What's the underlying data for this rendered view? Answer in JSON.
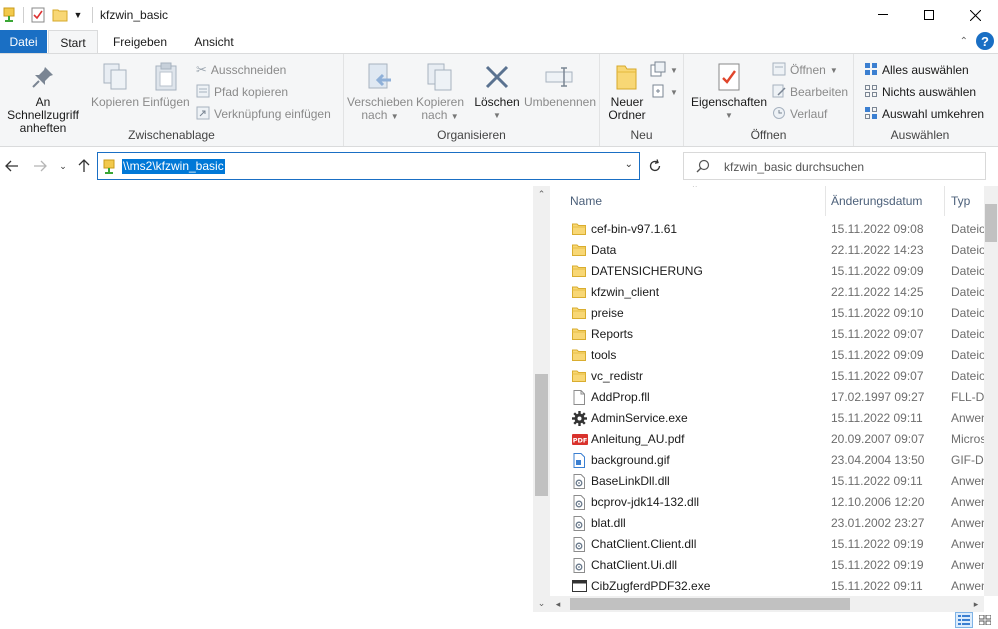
{
  "window": {
    "title": "kfzwin_basic"
  },
  "tabs": {
    "file": "Datei",
    "start": "Start",
    "share": "Freigeben",
    "view": "Ansicht"
  },
  "help": {
    "label": "?"
  },
  "ribbon": {
    "clipboard": {
      "label": "Zwischenablage",
      "pin_line1": "An Schnellzugriff",
      "pin_line2": "anheften",
      "copy": "Kopieren",
      "paste": "Einfügen",
      "cut": "Ausschneiden",
      "copy_path": "Pfad kopieren",
      "paste_shortcut": "Verknüpfung einfügen"
    },
    "organize": {
      "label": "Organisieren",
      "move_line1": "Verschieben",
      "move_line2": "nach",
      "copyto_line1": "Kopieren",
      "copyto_line2": "nach",
      "delete": "Löschen",
      "rename": "Umbenennen"
    },
    "new": {
      "label": "Neu",
      "folder_line1": "Neuer",
      "folder_line2": "Ordner"
    },
    "open": {
      "label": "Öffnen",
      "properties": "Eigenschaften",
      "open": "Öffnen",
      "edit": "Bearbeiten",
      "history": "Verlauf"
    },
    "select": {
      "label": "Auswählen",
      "all": "Alles auswählen",
      "none": "Nichts auswählen",
      "invert": "Auswahl umkehren"
    }
  },
  "address": {
    "path": "\\\\ms2\\kfzwin_basic"
  },
  "search": {
    "placeholder": "kfzwin_basic durchsuchen"
  },
  "columns": {
    "name": "Name",
    "date": "Änderungsdatum",
    "type": "Typ"
  },
  "files": [
    {
      "name": "cef-bin-v97.1.61",
      "date": "15.11.2022 09:08",
      "type": "Dateiordner",
      "icon": "folder"
    },
    {
      "name": "Data",
      "date": "22.11.2022 14:23",
      "type": "Dateiordner",
      "icon": "folder"
    },
    {
      "name": "DATENSICHERUNG",
      "date": "15.11.2022 09:09",
      "type": "Dateiordner",
      "icon": "folder"
    },
    {
      "name": "kfzwin_client",
      "date": "22.11.2022 14:25",
      "type": "Dateiordner",
      "icon": "folder"
    },
    {
      "name": "preise",
      "date": "15.11.2022 09:10",
      "type": "Dateiordner",
      "icon": "folder"
    },
    {
      "name": "Reports",
      "date": "15.11.2022 09:07",
      "type": "Dateiordner",
      "icon": "folder"
    },
    {
      "name": "tools",
      "date": "15.11.2022 09:09",
      "type": "Dateiordner",
      "icon": "folder"
    },
    {
      "name": "vc_redistr",
      "date": "15.11.2022 09:07",
      "type": "Dateiordner",
      "icon": "folder"
    },
    {
      "name": "AddProp.fll",
      "date": "17.02.1997 09:27",
      "type": "FLL-Datei",
      "icon": "file"
    },
    {
      "name": "AdminService.exe",
      "date": "15.11.2022 09:11",
      "type": "Anwendung",
      "icon": "gear"
    },
    {
      "name": "Anleitung_AU.pdf",
      "date": "20.09.2007 09:07",
      "type": "Microsoft Edge PDF",
      "icon": "pdf"
    },
    {
      "name": "background.gif",
      "date": "23.04.2004 13:50",
      "type": "GIF-Datei",
      "icon": "image"
    },
    {
      "name": "BaseLinkDll.dll",
      "date": "15.11.2022 09:11",
      "type": "Anwendungserweiterung",
      "icon": "dll"
    },
    {
      "name": "bcprov-jdk14-132.dll",
      "date": "12.10.2006 12:20",
      "type": "Anwendungserweiterung",
      "icon": "dll"
    },
    {
      "name": "blat.dll",
      "date": "23.01.2002 23:27",
      "type": "Anwendungserweiterung",
      "icon": "dll"
    },
    {
      "name": "ChatClient.Client.dll",
      "date": "15.11.2022 09:19",
      "type": "Anwendungserweiterung",
      "icon": "dll"
    },
    {
      "name": "ChatClient.Ui.dll",
      "date": "15.11.2022 09:19",
      "type": "Anwendungserweiterung",
      "icon": "dll"
    },
    {
      "name": "CibZugferdPDF32.exe",
      "date": "15.11.2022 09:11",
      "type": "Anwendung",
      "icon": "window"
    }
  ]
}
